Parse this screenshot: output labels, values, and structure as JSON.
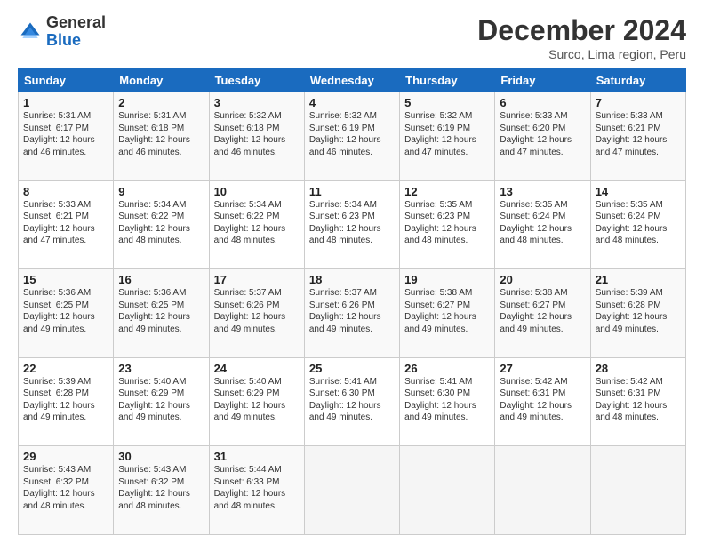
{
  "header": {
    "logo_general": "General",
    "logo_blue": "Blue",
    "month": "December 2024",
    "location": "Surco, Lima region, Peru"
  },
  "days_of_week": [
    "Sunday",
    "Monday",
    "Tuesday",
    "Wednesday",
    "Thursday",
    "Friday",
    "Saturday"
  ],
  "weeks": [
    [
      {
        "day": "1",
        "sunrise": "5:31 AM",
        "sunset": "6:17 PM",
        "daylight": "12 hours and 46 minutes."
      },
      {
        "day": "2",
        "sunrise": "5:31 AM",
        "sunset": "6:18 PM",
        "daylight": "12 hours and 46 minutes."
      },
      {
        "day": "3",
        "sunrise": "5:32 AM",
        "sunset": "6:18 PM",
        "daylight": "12 hours and 46 minutes."
      },
      {
        "day": "4",
        "sunrise": "5:32 AM",
        "sunset": "6:19 PM",
        "daylight": "12 hours and 46 minutes."
      },
      {
        "day": "5",
        "sunrise": "5:32 AM",
        "sunset": "6:19 PM",
        "daylight": "12 hours and 47 minutes."
      },
      {
        "day": "6",
        "sunrise": "5:33 AM",
        "sunset": "6:20 PM",
        "daylight": "12 hours and 47 minutes."
      },
      {
        "day": "7",
        "sunrise": "5:33 AM",
        "sunset": "6:21 PM",
        "daylight": "12 hours and 47 minutes."
      }
    ],
    [
      {
        "day": "8",
        "sunrise": "5:33 AM",
        "sunset": "6:21 PM",
        "daylight": "12 hours and 47 minutes."
      },
      {
        "day": "9",
        "sunrise": "5:34 AM",
        "sunset": "6:22 PM",
        "daylight": "12 hours and 48 minutes."
      },
      {
        "day": "10",
        "sunrise": "5:34 AM",
        "sunset": "6:22 PM",
        "daylight": "12 hours and 48 minutes."
      },
      {
        "day": "11",
        "sunrise": "5:34 AM",
        "sunset": "6:23 PM",
        "daylight": "12 hours and 48 minutes."
      },
      {
        "day": "12",
        "sunrise": "5:35 AM",
        "sunset": "6:23 PM",
        "daylight": "12 hours and 48 minutes."
      },
      {
        "day": "13",
        "sunrise": "5:35 AM",
        "sunset": "6:24 PM",
        "daylight": "12 hours and 48 minutes."
      },
      {
        "day": "14",
        "sunrise": "5:35 AM",
        "sunset": "6:24 PM",
        "daylight": "12 hours and 48 minutes."
      }
    ],
    [
      {
        "day": "15",
        "sunrise": "5:36 AM",
        "sunset": "6:25 PM",
        "daylight": "12 hours and 49 minutes."
      },
      {
        "day": "16",
        "sunrise": "5:36 AM",
        "sunset": "6:25 PM",
        "daylight": "12 hours and 49 minutes."
      },
      {
        "day": "17",
        "sunrise": "5:37 AM",
        "sunset": "6:26 PM",
        "daylight": "12 hours and 49 minutes."
      },
      {
        "day": "18",
        "sunrise": "5:37 AM",
        "sunset": "6:26 PM",
        "daylight": "12 hours and 49 minutes."
      },
      {
        "day": "19",
        "sunrise": "5:38 AM",
        "sunset": "6:27 PM",
        "daylight": "12 hours and 49 minutes."
      },
      {
        "day": "20",
        "sunrise": "5:38 AM",
        "sunset": "6:27 PM",
        "daylight": "12 hours and 49 minutes."
      },
      {
        "day": "21",
        "sunrise": "5:39 AM",
        "sunset": "6:28 PM",
        "daylight": "12 hours and 49 minutes."
      }
    ],
    [
      {
        "day": "22",
        "sunrise": "5:39 AM",
        "sunset": "6:28 PM",
        "daylight": "12 hours and 49 minutes."
      },
      {
        "day": "23",
        "sunrise": "5:40 AM",
        "sunset": "6:29 PM",
        "daylight": "12 hours and 49 minutes."
      },
      {
        "day": "24",
        "sunrise": "5:40 AM",
        "sunset": "6:29 PM",
        "daylight": "12 hours and 49 minutes."
      },
      {
        "day": "25",
        "sunrise": "5:41 AM",
        "sunset": "6:30 PM",
        "daylight": "12 hours and 49 minutes."
      },
      {
        "day": "26",
        "sunrise": "5:41 AM",
        "sunset": "6:30 PM",
        "daylight": "12 hours and 49 minutes."
      },
      {
        "day": "27",
        "sunrise": "5:42 AM",
        "sunset": "6:31 PM",
        "daylight": "12 hours and 49 minutes."
      },
      {
        "day": "28",
        "sunrise": "5:42 AM",
        "sunset": "6:31 PM",
        "daylight": "12 hours and 48 minutes."
      }
    ],
    [
      {
        "day": "29",
        "sunrise": "5:43 AM",
        "sunset": "6:32 PM",
        "daylight": "12 hours and 48 minutes."
      },
      {
        "day": "30",
        "sunrise": "5:43 AM",
        "sunset": "6:32 PM",
        "daylight": "12 hours and 48 minutes."
      },
      {
        "day": "31",
        "sunrise": "5:44 AM",
        "sunset": "6:33 PM",
        "daylight": "12 hours and 48 minutes."
      },
      null,
      null,
      null,
      null
    ]
  ]
}
